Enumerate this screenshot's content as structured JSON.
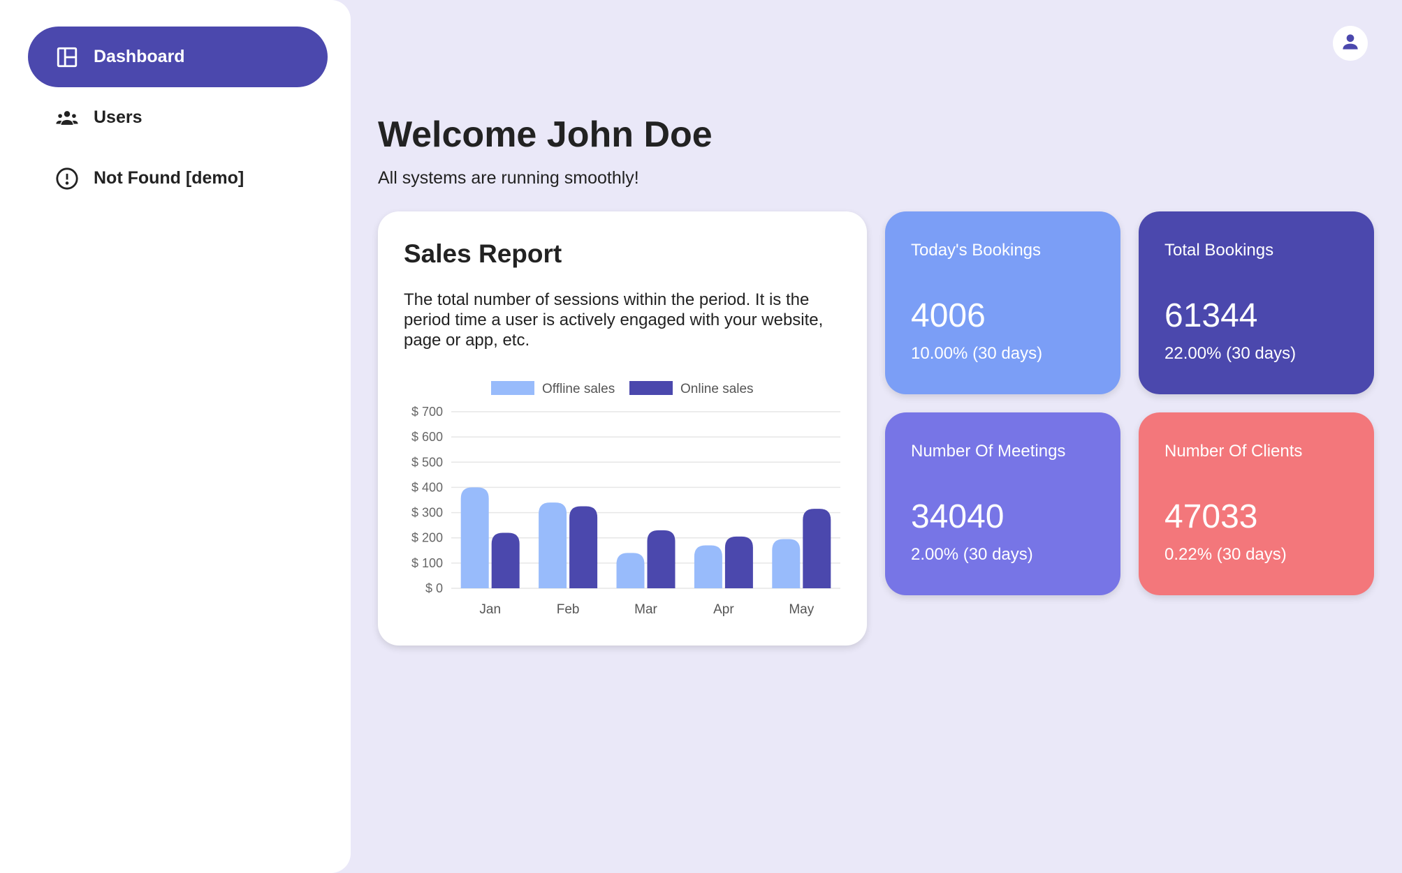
{
  "sidebar": {
    "items": [
      {
        "label": "Dashboard",
        "icon": "dashboard-icon",
        "active": true
      },
      {
        "label": "Users",
        "icon": "users-icon",
        "active": false
      },
      {
        "label": "Not Found [demo]",
        "icon": "alert-circle-icon",
        "active": false
      }
    ]
  },
  "header": {
    "avatar_icon": "user-icon"
  },
  "main": {
    "title": "Welcome John Doe",
    "subtitle": "All systems are running smoothly!"
  },
  "sales_report": {
    "title": "Sales Report",
    "description": "The total number of sessions within the period. It is the period time a user is actively engaged with your website, page or app, etc."
  },
  "chart_data": {
    "type": "bar",
    "categories": [
      "Jan",
      "Feb",
      "Mar",
      "Apr",
      "May"
    ],
    "series": [
      {
        "name": "Offline sales",
        "values": [
          400,
          340,
          140,
          170,
          195
        ],
        "color": "#98bbfb"
      },
      {
        "name": "Online sales",
        "values": [
          220,
          325,
          230,
          205,
          315
        ],
        "color": "#4b48ad"
      }
    ],
    "yticks": [
      "$ 0",
      "$ 100",
      "$ 200",
      "$ 300",
      "$ 400",
      "$ 500",
      "$ 600",
      "$ 700"
    ],
    "ylim": [
      0,
      700
    ],
    "legend": "top",
    "grid": true
  },
  "stats": [
    {
      "label": "Today's Bookings",
      "value": "4006",
      "change": "10.00% (30 days)",
      "color": "#7b9ef6"
    },
    {
      "label": "Total Bookings",
      "value": "61344",
      "change": "22.00% (30 days)",
      "color": "#4b48ad"
    },
    {
      "label": "Number Of Meetings",
      "value": "34040",
      "change": "2.00% (30 days)",
      "color": "#7775e6"
    },
    {
      "label": "Number Of Clients",
      "value": "47033",
      "change": "0.22% (30 days)",
      "color": "#f3777b"
    }
  ]
}
